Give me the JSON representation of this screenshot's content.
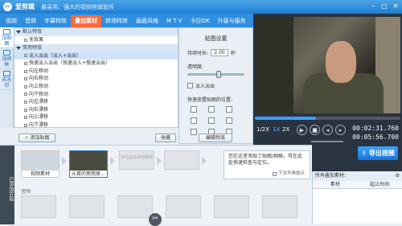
{
  "window": {
    "app_name": "爱剪辑",
    "tagline": "最易用、强大的视频剪辑软件",
    "min": "–",
    "max": "□",
    "close": "✕"
  },
  "tabs": [
    {
      "label": "视频"
    },
    {
      "label": "音频"
    },
    {
      "label": "字幕特效"
    },
    {
      "label": "叠加素材"
    },
    {
      "label": "转场特效"
    },
    {
      "label": "画面风格"
    },
    {
      "label": "M T V"
    },
    {
      "label": "卡拉OK"
    },
    {
      "label": "升级与服务"
    }
  ],
  "sidenav": [
    {
      "label": "加贴图"
    },
    {
      "label": "加相框"
    },
    {
      "label": "去水印"
    }
  ],
  "effects": {
    "group1": "默认特效",
    "group1_items": [
      "无效果"
    ],
    "group2": "常用特效",
    "group2_items": [
      "淡入淡出（淡入+淡出）",
      "快速淡入淡出（快速淡入+慢速淡出）",
      "向左移动",
      "向右移动",
      "向上移动",
      "向下移动",
      "向左漂移",
      "向右漂移",
      "向上漂移",
      "向下漂移"
    ]
  },
  "settings": {
    "title": "贴图设置",
    "duration_label": "持续时长:",
    "duration_value": "2.00",
    "duration_unit": "秒",
    "opacity_label": "透明度:",
    "fade_label": "淡入淡出",
    "motion_label": "快速放置贴图的位置:",
    "edit_button": "编辑特效"
  },
  "bottombar": {
    "add_button": "添加贴图",
    "collect_button": "收藏"
  },
  "player": {
    "progress": 0.42,
    "speeds": [
      "1/2X",
      "1X",
      "2X"
    ],
    "current_time": "00:02:31.760",
    "total_time": "00:05:56.700",
    "export_label": "导出视频"
  },
  "timeline": {
    "sidebar_label": "已添加片段",
    "clips": [
      {
        "label": "视频素材"
      },
      {
        "label": "元首的愤怒原…"
      }
    ],
    "placeholder": "双击此处添加视频",
    "track2_label": "音频",
    "tip_text": "您在这里添加了贴图/相框，可在此处快速检查与定位。",
    "tip_checkbox": "下次不再提示"
  },
  "rightpanel": {
    "title": "所有叠加素材：",
    "col1": "素材",
    "col2": "起止时间"
  },
  "colors": {
    "accent": "#1f7fd4",
    "active_tab": "#ff6a3d",
    "export": "#1476d8"
  }
}
